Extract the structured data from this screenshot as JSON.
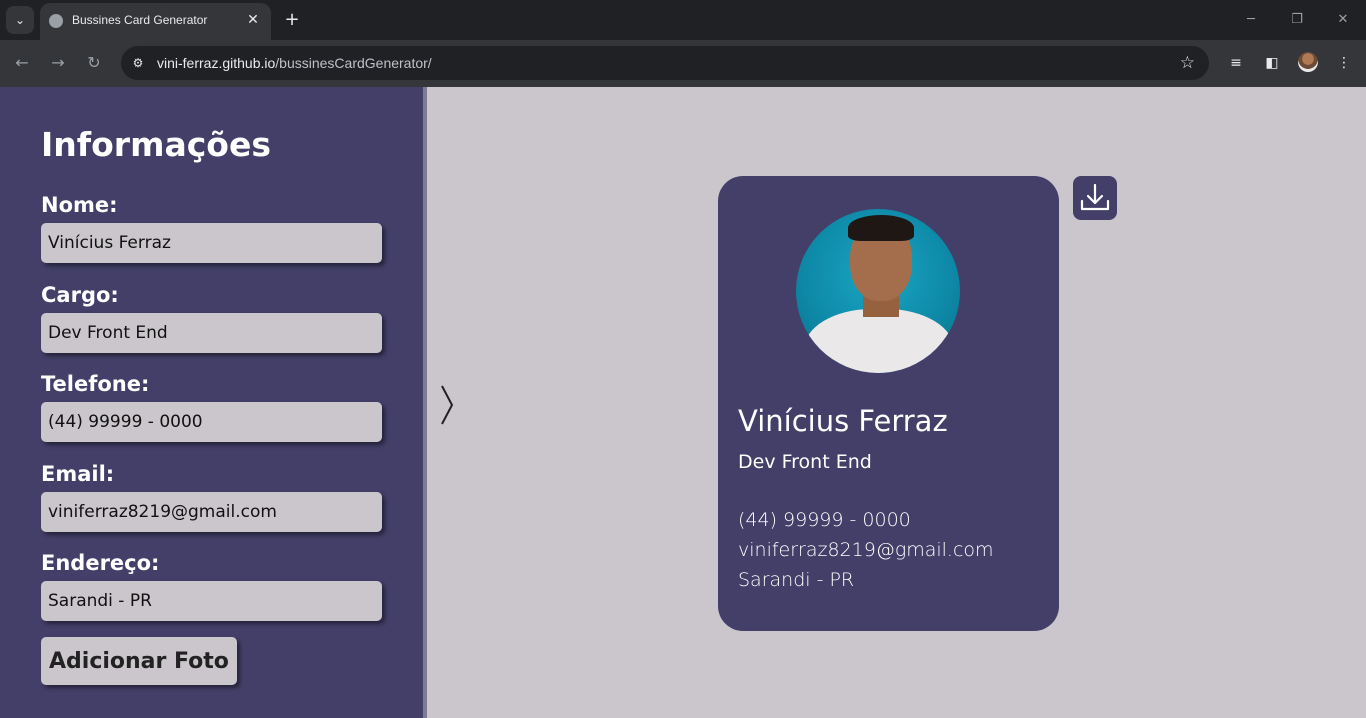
{
  "browser": {
    "tab_title": "Bussines Card Generator",
    "url_host": "vini-ferraz.github.io",
    "url_path": "/bussinesCardGenerator/"
  },
  "sidebar": {
    "title": "Informações",
    "fields": [
      {
        "label": "Nome:",
        "value": "Vinícius Ferraz"
      },
      {
        "label": "Cargo:",
        "value": "Dev Front End"
      },
      {
        "label": "Telefone:",
        "value": "(44) 99999 - 0000"
      },
      {
        "label": "Email:",
        "value": "viniferraz8219@gmail.com"
      },
      {
        "label": "Endereço:",
        "value": "Sarandi - PR"
      }
    ],
    "add_photo_label": "Adicionar Foto"
  },
  "card": {
    "name": "Vinícius Ferraz",
    "role": "Dev Front End",
    "phone": "(44) 99999 - 0000",
    "email": "viniferraz8219@gmail.com",
    "address": "Sarandi - PR"
  },
  "colors": {
    "sidebar_bg": "#433f69",
    "page_bg": "#cbc6cc",
    "card_bg": "#433f69",
    "input_bg": "#cbc6cc"
  },
  "icons": {
    "toggle": "chevron-right-icon",
    "download": "download-icon"
  }
}
